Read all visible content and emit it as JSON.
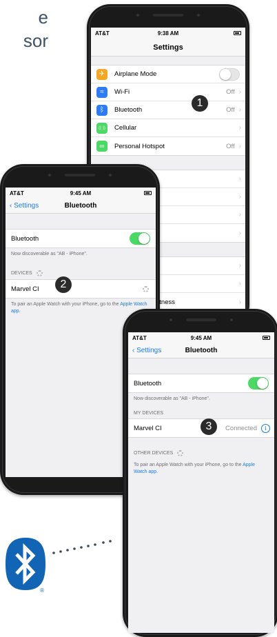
{
  "intro": {
    "line1": "e",
    "line2": "sor"
  },
  "phone1": {
    "carrier": "AT&T",
    "time": "9:38 AM",
    "nav_title": "Settings",
    "rows": [
      {
        "label": "Airplane Mode",
        "icon": "airplane-icon",
        "color": "#f5a623",
        "glyph": "✈",
        "value": "",
        "toggle": "off",
        "chev": false
      },
      {
        "label": "Wi-Fi",
        "icon": "wifi-icon",
        "color": "#2d7cf6",
        "glyph": "≈",
        "value": "Off",
        "chev": true
      },
      {
        "label": "Bluetooth",
        "icon": "bluetooth-icon",
        "color": "#2d7cf6",
        "glyph": "ᛒ",
        "value": "Off",
        "chev": true
      },
      {
        "label": "Cellular",
        "icon": "cellular-icon",
        "color": "#4cd864",
        "glyph": "((·))",
        "value": "",
        "chev": true
      },
      {
        "label": "Personal Hotspot",
        "icon": "hotspot-icon",
        "color": "#4cd864",
        "glyph": "∞",
        "value": "Off",
        "chev": true
      }
    ],
    "partial_text": "htness",
    "step": "1"
  },
  "phone2": {
    "carrier": "AT&T",
    "time": "9:45 AM",
    "back_label": "Settings",
    "nav_title": "Bluetooth",
    "bt_label": "Bluetooth",
    "discoverable": "Now discoverable as \"AB - iPhone\".",
    "devices_header": "DEVICES",
    "device": "Marvel CI",
    "pair_note": "To pair an Apple Watch with your iPhone, go to the",
    "pair_link": "Apple Watch app.",
    "step": "2"
  },
  "phone3": {
    "carrier": "AT&T",
    "time": "9:45 AM",
    "back_label": "Settings",
    "nav_title": "Bluetooth",
    "bt_label": "Bluetooth",
    "discoverable": "Now discoverable as \"AB - iPhone\".",
    "my_devices_header": "MY DEVICES",
    "device": "Marvel CI",
    "device_status": "Connected",
    "other_devices_header": "OTHER DEVICES",
    "pair_note": "To pair an Apple Watch with your iPhone, go to the",
    "pair_link": "Apple Watch app.",
    "step": "3"
  },
  "logo": {
    "registered": "®"
  },
  "colors": {
    "accent": "#1a7cf0",
    "toggle_on": "#4cd864",
    "logo_blue": "#1264b4"
  }
}
